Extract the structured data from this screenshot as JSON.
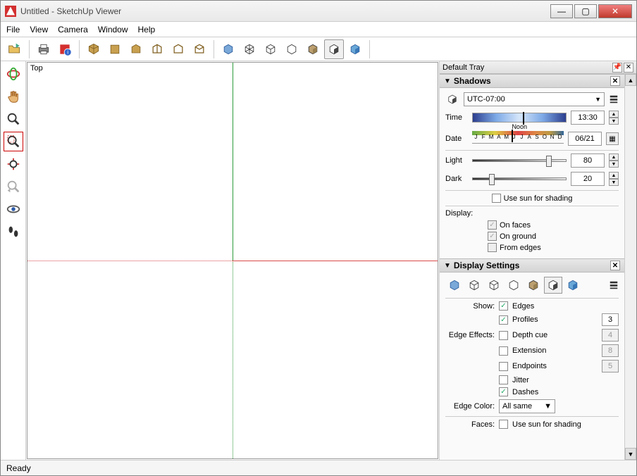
{
  "window": {
    "title": "Untitled - SketchUp Viewer"
  },
  "menubar": [
    "File",
    "View",
    "Camera",
    "Window",
    "Help"
  ],
  "viewport": {
    "label": "Top"
  },
  "statusbar": {
    "text": "Ready"
  },
  "tray": {
    "title": "Default Tray",
    "shadows": {
      "title": "Shadows",
      "timezone": "UTC-07:00",
      "time_label": "Time",
      "time_value": "13:30",
      "noon_label": "Noon",
      "date_label": "Date",
      "date_value": "06/21",
      "months": [
        "J",
        "F",
        "M",
        "A",
        "M",
        "J",
        "J",
        "A",
        "S",
        "O",
        "N",
        "D"
      ],
      "light_label": "Light",
      "light_value": "80",
      "dark_label": "Dark",
      "dark_value": "20",
      "use_sun": "Use sun for shading",
      "display_label": "Display:",
      "on_faces": "On faces",
      "on_ground": "On ground",
      "from_edges": "From edges"
    },
    "display_settings": {
      "title": "Display Settings",
      "show_label": "Show:",
      "edges": "Edges",
      "profiles": "Profiles",
      "profiles_val": "3",
      "edge_effects_label": "Edge Effects:",
      "depth_cue": "Depth cue",
      "depth_cue_val": "4",
      "extension": "Extension",
      "extension_val": "8",
      "endpoints": "Endpoints",
      "endpoints_val": "5",
      "jitter": "Jitter",
      "dashes": "Dashes",
      "edge_color_label": "Edge Color:",
      "edge_color_value": "All same",
      "faces_label": "Faces:",
      "faces_use_sun": "Use sun for shading"
    }
  }
}
